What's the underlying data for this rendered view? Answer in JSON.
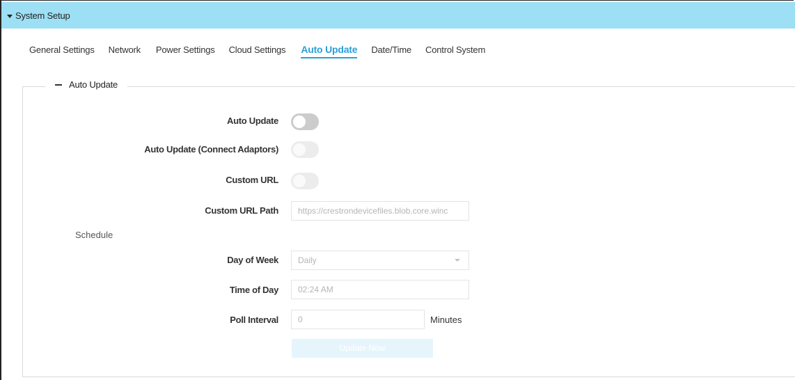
{
  "section": {
    "title": "System Setup"
  },
  "tabs": [
    {
      "label": "General Settings",
      "active": false
    },
    {
      "label": "Network",
      "active": false
    },
    {
      "label": "Power Settings",
      "active": false
    },
    {
      "label": "Cloud Settings",
      "active": false
    },
    {
      "label": "Auto Update",
      "active": true
    },
    {
      "label": "Date/Time",
      "active": false
    },
    {
      "label": "Control System",
      "active": false
    }
  ],
  "auto_update_panel": {
    "legend": "Auto Update",
    "auto_update": {
      "label": "Auto Update",
      "enabled": false
    },
    "auto_update_connect_adaptors": {
      "label": "Auto Update (Connect Adaptors)",
      "enabled": false
    },
    "custom_url": {
      "label": "Custom URL",
      "enabled": false
    },
    "custom_url_path": {
      "label": "Custom URL Path",
      "value": "https://crestrondevicefiles.blob.core.winc"
    },
    "schedule_heading": "Schedule",
    "day_of_week": {
      "label": "Day of Week",
      "value": "Daily"
    },
    "time_of_day": {
      "label": "Time of Day",
      "value": "02:24 AM"
    },
    "poll_interval": {
      "label": "Poll Interval",
      "value": "0",
      "unit": "Minutes"
    },
    "update_now_label": "Update Now"
  },
  "colors": {
    "header_bg": "#9ddff4",
    "accent": "#2a9fd8",
    "button_disabled_bg": "#e6f5fc"
  }
}
